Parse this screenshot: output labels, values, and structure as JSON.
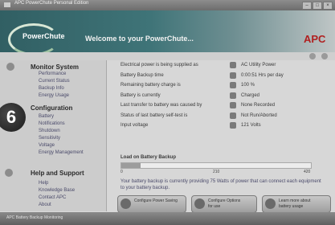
{
  "window": {
    "title": "APC PowerChute Personal Edition"
  },
  "banner": {
    "logo": "PowerChute",
    "welcome": "Welcome to your PowerChute...",
    "brand": "APC"
  },
  "toolbar": {
    "icons": [
      "home-icon",
      "help-icon"
    ]
  },
  "sidebar": {
    "monitor": {
      "title": "Monitor System",
      "items": [
        "Performance",
        "Current Status",
        "Backup Info",
        "Energy Usage"
      ]
    },
    "config": {
      "title": "Configuration",
      "items": [
        "Battery",
        "Notifications",
        "Shutdown",
        "Sensitivity",
        "Voltage",
        "Energy Management"
      ]
    },
    "help": {
      "title": "Help and Support",
      "items": [
        "Help",
        "Knowledge Base",
        "Contact APC",
        "About"
      ]
    },
    "badge": "6"
  },
  "status": {
    "rows": [
      {
        "label": "Electrical power is being supplied as",
        "value": "AC Utility Power",
        "icon": "plug-icon"
      },
      {
        "label": "Battery Backup time",
        "value": "0:00:51 Hrs per day",
        "icon": "clock-icon"
      },
      {
        "label": "Remaining battery charge is",
        "value": "100 %",
        "icon": "battery-icon"
      },
      {
        "label": "Battery is currently",
        "value": "Charged",
        "icon": "check-icon"
      },
      {
        "label": "Last transfer to battery was caused by",
        "value": "None Recorded",
        "icon": "lightning-icon"
      },
      {
        "label": "Status of last battery self-test is",
        "value": "Not Run/Aborted",
        "icon": "test-icon"
      },
      {
        "label": "Input voltage",
        "value": "121 Volts",
        "icon": "gauge-icon"
      }
    ]
  },
  "load": {
    "title": "Load on Battery Backup",
    "progress": 0.1,
    "ticks": [
      "0",
      "210",
      "420"
    ],
    "unit": "Watts",
    "note": "Your battery backup is currently providing 75 Watts of power that can connect each equipment to your battery backup."
  },
  "footer": {
    "buttons": [
      {
        "label": "Configure Power Saving",
        "icon": "leaf-icon"
      },
      {
        "label": "Configure Options\nfor use",
        "icon": "options-icon"
      },
      {
        "label": "Learn more about\nbattery usage",
        "icon": "info-icon"
      }
    ]
  },
  "statusbar": {
    "text": "APC Battery Backup Monitoring"
  }
}
